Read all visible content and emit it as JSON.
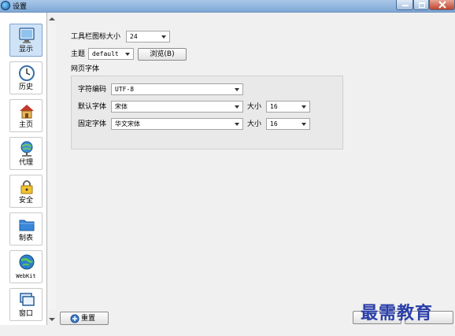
{
  "window": {
    "title": "设置"
  },
  "sidebar": {
    "items": [
      {
        "label": "显示",
        "icon": "monitor-icon",
        "active": true
      },
      {
        "label": "历史",
        "icon": "clock-icon"
      },
      {
        "label": "主页",
        "icon": "home-icon"
      },
      {
        "label": "代理",
        "icon": "globe-network-icon"
      },
      {
        "label": "安全",
        "icon": "lock-icon"
      },
      {
        "label": "制表",
        "icon": "folder-icon"
      },
      {
        "label": "WebKit",
        "icon": "webkit-globe-icon"
      },
      {
        "label": "窗口",
        "icon": "window-icon"
      }
    ]
  },
  "display": {
    "toolbar_icon_size": {
      "label": "工具栏图标大小",
      "value": "24"
    },
    "theme": {
      "label": "主题",
      "value": "default",
      "browse_button": "浏览(B)"
    },
    "web_fonts": {
      "group_label": "网页字体",
      "encoding": {
        "label": "字符编码",
        "value": "UTF-8"
      },
      "default_font": {
        "label": "默认字体",
        "value": "宋体",
        "size_label": "大小",
        "size_value": "16"
      },
      "fixed_font": {
        "label": "固定字体",
        "value": "华文宋体",
        "size_label": "大小",
        "size_value": "16"
      }
    }
  },
  "footer": {
    "reset_button": "重置"
  },
  "watermark": "最需教育",
  "colors": {
    "titlebar": "#7fa8d6",
    "active_nav": "#cfe3f7",
    "watermark": "#2a3fa8"
  }
}
